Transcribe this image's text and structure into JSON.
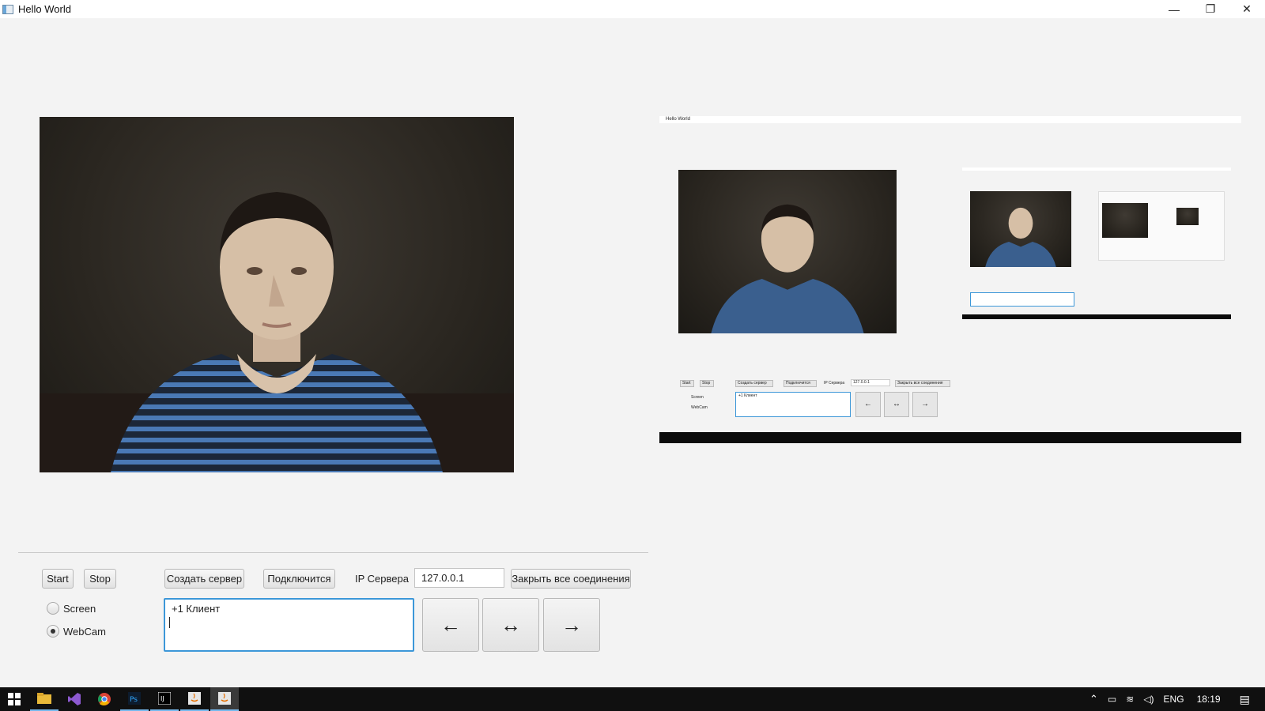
{
  "window": {
    "title": "Hello World"
  },
  "window_controls": {
    "minimize": "—",
    "restore": "❐",
    "close": "✕"
  },
  "toolbar": {
    "start_label": "Start",
    "stop_label": "Stop",
    "create_server_label": "Создать сервер",
    "connect_label": "Подключится",
    "server_ip_label": "IP Сервера",
    "server_ip_value": "127.0.0.1",
    "close_all_label": "Закрыть все соединения"
  },
  "source": {
    "options": [
      {
        "label": "Screen",
        "checked": false
      },
      {
        "label": "WebCam",
        "checked": true
      }
    ]
  },
  "log": {
    "text": "+1 Клиент"
  },
  "arrows": {
    "left": "←",
    "both": "↔",
    "right": "→"
  },
  "preview": {
    "title": "Hello World",
    "start_label": "Start",
    "stop_label": "Stop",
    "create_server_label": "Создать сервер",
    "connect_label": "Подключится",
    "server_ip_label": "IP Сервера",
    "server_ip_value": "127.0.0.1",
    "close_all_label": "Закрыть все соединения",
    "screen_label": "Screen",
    "webcam_label": "WebCam",
    "log_text": "+1 Клиент",
    "arrows": [
      "←",
      "↔",
      "→"
    ]
  },
  "taskbar": {
    "apps": [
      "windows-start",
      "file-explorer",
      "visual-studio",
      "chrome",
      "photoshop",
      "intellij",
      "java",
      "java-app"
    ],
    "language": "ENG",
    "clock": "18:19"
  }
}
